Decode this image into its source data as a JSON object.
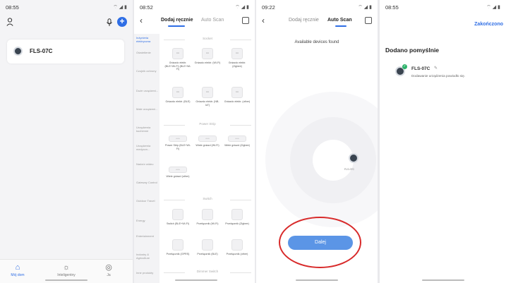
{
  "screen1": {
    "status_time": "08:55",
    "device_name": "FLS-07C",
    "tabs": [
      {
        "label": "Mój dom",
        "icon": "home-icon"
      },
      {
        "label": "Inteligentny",
        "icon": "sun-icon"
      },
      {
        "label": "Ja",
        "icon": "profile-icon"
      }
    ]
  },
  "screen2": {
    "status_time": "08:52",
    "tab_manual": "Dodaj ręcznie",
    "tab_auto": "Auto Scan",
    "categories": [
      "Inżynieria elektryczna",
      "Oświetlenie",
      "Czujnik ochrony",
      "Duże urządzeni...",
      "Małe urządzeni...",
      "Urządzenia kuchenne",
      "Urządzenia medyczn...",
      "Nadzór wideo",
      "Gateway Control",
      "Outdoor Travel",
      "Energy",
      "Entertainment",
      "Industry & Agriculture",
      "Inne produkty"
    ],
    "sections": {
      "socket": "Socket",
      "power_strip": "Power Strip",
      "switch": "Switch",
      "dimmer": "Dimmer Switch"
    },
    "products": [
      "Gniazdo elektr. (BLE+Wi-Fi) (BLE+Wi-Fi)",
      "Gniazdo elektr. (Wi-Fi)",
      "Gniazdo elektr. (Zigbee)",
      "Gniazdo elektr. (BLE)",
      "Gniazdo elektr. (NB-IoT)",
      "Gniazdo elektr. (other)",
      "Power Strip (BLE+Wi-Fi)",
      "Wiele gniazd (Wi-Fi)",
      "Wiele gniazd (Zigbee)",
      "Wiele gniazd (other)",
      "Switch (BLE+Wi-Fi)",
      "Przełącznik (Wi-Fi)",
      "Przełącznik (Zigbee)",
      "Przełącznik (GPRS)",
      "Przełącznik (BLE)",
      "Przełącznik (other)"
    ]
  },
  "screen3": {
    "status_time": "09:22",
    "tab_manual": "Dodaj ręcznie",
    "tab_auto": "Auto Scan",
    "found_text": "Available devices found",
    "device_label": "FLS-07C",
    "button": "Dalej",
    "highlight_color": "#d82a2a"
  },
  "screen4": {
    "status_time": "08:55",
    "done": "Zakończono",
    "title": "Dodano pomyślnie",
    "device_name": "FLS-07C",
    "message": "Dodawanie urządzenia powiodło się."
  },
  "accent_color": "#2f6ee5"
}
